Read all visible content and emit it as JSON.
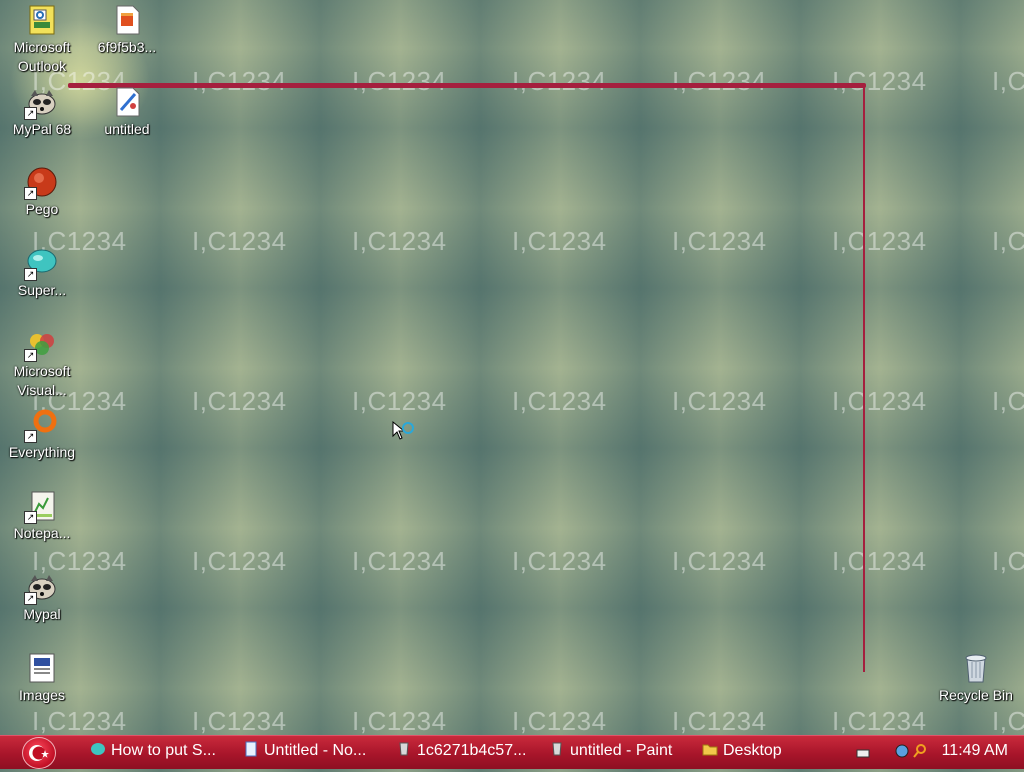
{
  "watermark": {
    "text": "I,C1234"
  },
  "desktop_icons": [
    {
      "name": "icon-microsoft-outlook",
      "label": "Microsoft Outlook",
      "icon": "outlook-icon"
    },
    {
      "name": "icon-6f9f5b3",
      "label": "6f9f5b3...",
      "icon": "html-file-icon"
    },
    {
      "name": "icon-mypal-68",
      "label": "MyPal 68",
      "icon": "mypal-raccoon-icon"
    },
    {
      "name": "icon-untitled",
      "label": "untitled",
      "icon": "paint-file-icon"
    },
    {
      "name": "icon-pego",
      "label": "Pego",
      "icon": "pego-icon"
    },
    {
      "name": "icon-super",
      "label": "Super...",
      "icon": "super-icon"
    },
    {
      "name": "icon-microsoft-visual",
      "label": "Microsoft Visual...",
      "icon": "visual-studio-icon"
    },
    {
      "name": "icon-everything",
      "label": "Everything",
      "icon": "everything-search-icon"
    },
    {
      "name": "icon-notepad",
      "label": "Notepa...",
      "icon": "notepad-icon"
    },
    {
      "name": "icon-mypal",
      "label": "Mypal",
      "icon": "mypal-raccoon-icon"
    },
    {
      "name": "icon-images",
      "label": "Images",
      "icon": "images-folder-icon"
    },
    {
      "name": "icon-recycle-bin",
      "label": "Recycle Bin",
      "icon": "recycle-bin-icon"
    }
  ],
  "taskbar": {
    "tasks": [
      {
        "label": "How to put S...",
        "icon": "super-icon"
      },
      {
        "label": "Untitled - No...",
        "icon": "notepad-icon"
      },
      {
        "label": "1c6271b4c57...",
        "icon": "paint-icon"
      },
      {
        "label": "untitled - Paint",
        "icon": "paint-icon"
      },
      {
        "label": "Desktop",
        "icon": "folder-icon"
      }
    ],
    "clock": "11:49 AM"
  },
  "colors": {
    "taskbar": "#b01a30",
    "annotation_line": "#a51f3e"
  }
}
